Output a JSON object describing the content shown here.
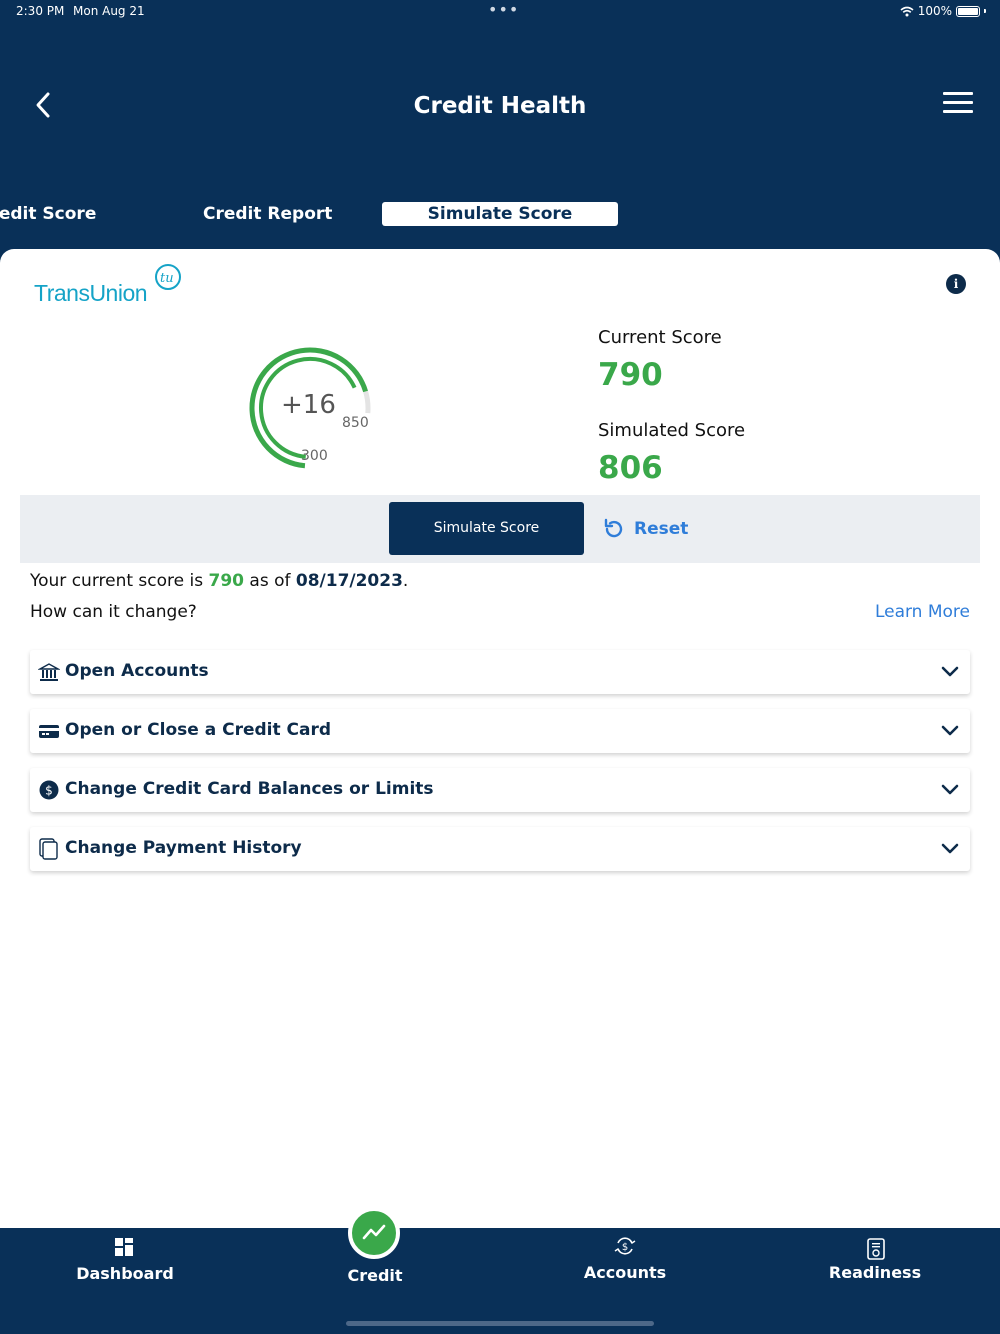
{
  "status_bar": {
    "time": "2:30 PM",
    "date": "Mon Aug 21",
    "dots": "•••",
    "battery": "100%"
  },
  "header": {
    "title": "Credit Health",
    "back_icon": "chevron-left-icon",
    "menu_icon": "hamburger-menu-icon"
  },
  "tabs": [
    {
      "label": "Credit Score",
      "active": false
    },
    {
      "label": "Credit Report",
      "active": false
    },
    {
      "label": "Simulate Score",
      "active": true
    }
  ],
  "provider": {
    "name": "TransUnion",
    "mark": "tu"
  },
  "gauge": {
    "delta": "+16",
    "min": "300",
    "max": "850",
    "current": 790,
    "simulated": 806,
    "color": "#3aa84a"
  },
  "scores": {
    "current_label": "Current Score",
    "current_value": "790",
    "simulated_label": "Simulated Score",
    "simulated_value": "806"
  },
  "actions": {
    "simulate_label": "Simulate Score",
    "reset_label": "Reset"
  },
  "summary": {
    "prefix": "Your current score is ",
    "score": "790",
    "mid": " as of ",
    "date": "08/17/2023",
    "suffix": ".",
    "question": "How can it change?",
    "learn_more": "Learn More"
  },
  "accordions": [
    {
      "label": "Open Accounts",
      "icon": "bank-icon"
    },
    {
      "label": "Open or Close a Credit Card",
      "icon": "credit-card-icon"
    },
    {
      "label": "Change Credit Card Balances or Limits",
      "icon": "dollar-circle-icon"
    },
    {
      "label": "Change Payment History",
      "icon": "documents-icon"
    }
  ],
  "bottom_nav": [
    {
      "label": "Dashboard",
      "icon": "dashboard-grid-icon"
    },
    {
      "label": "Credit",
      "icon": "trend-line-icon",
      "active": true
    },
    {
      "label": "Accounts",
      "icon": "dollar-refresh-icon"
    },
    {
      "label": "Readiness",
      "icon": "checklist-document-icon"
    }
  ],
  "colors": {
    "navy": "#093058",
    "green": "#3aa84a",
    "link_blue": "#2f7dd9",
    "transunion_teal": "#15a3c7"
  }
}
